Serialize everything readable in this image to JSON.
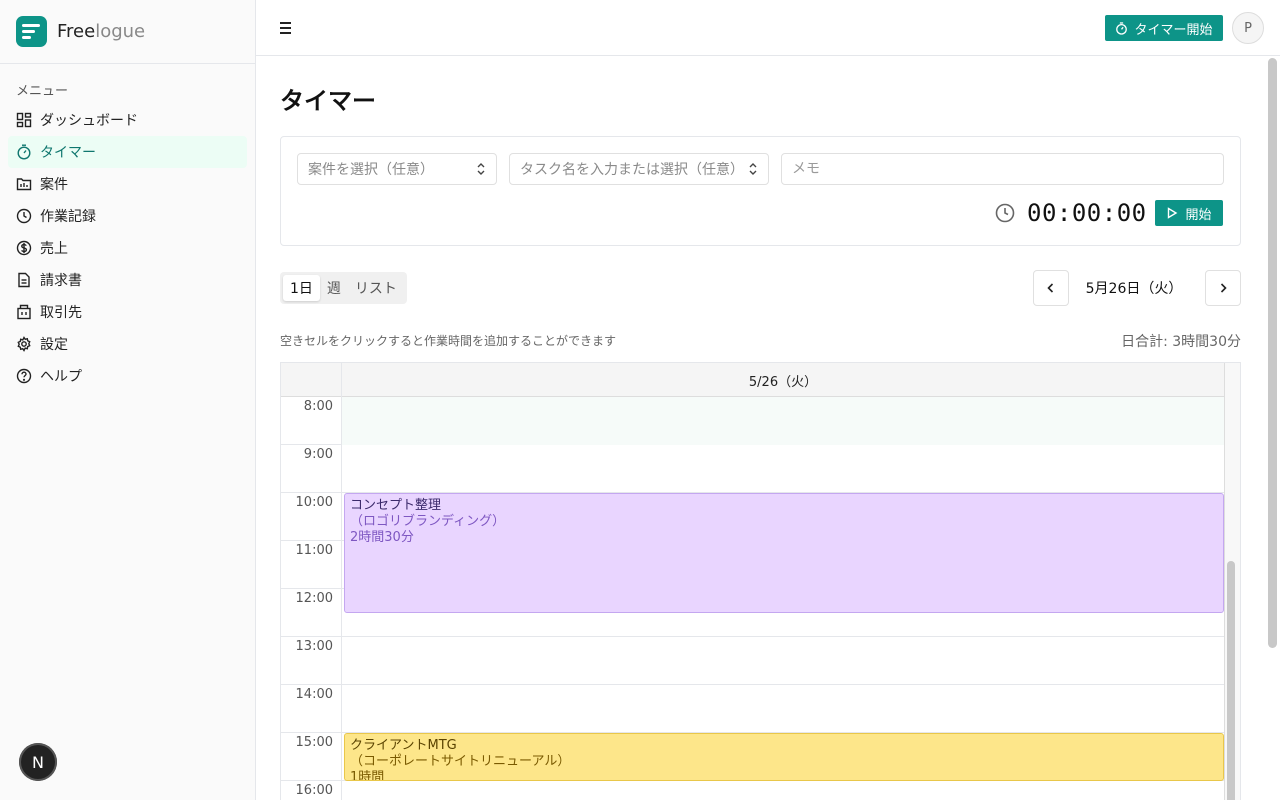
{
  "brand": {
    "name_main": "Free",
    "name_suffix": "logue"
  },
  "sidebar": {
    "heading": "メニュー",
    "items": [
      {
        "label": "ダッシュボード",
        "icon": "dashboard-icon"
      },
      {
        "label": "タイマー",
        "icon": "stopwatch-icon",
        "active": true
      },
      {
        "label": "案件",
        "icon": "folder-icon"
      },
      {
        "label": "作業記録",
        "icon": "clock-icon"
      },
      {
        "label": "売上",
        "icon": "dollar-icon"
      },
      {
        "label": "請求書",
        "icon": "document-icon"
      },
      {
        "label": "取引先",
        "icon": "building-icon"
      },
      {
        "label": "設定",
        "icon": "gear-icon"
      },
      {
        "label": "ヘルプ",
        "icon": "help-icon"
      }
    ],
    "badge": "N"
  },
  "header": {
    "timer_button": "タイマー開始",
    "avatar_initial": "P"
  },
  "page": {
    "title": "タイマー"
  },
  "timer": {
    "project_placeholder": "案件を選択（任意）",
    "task_placeholder": "タスク名を入力または選択（任意）",
    "memo_placeholder": "メモ",
    "elapsed": "00:00:00",
    "start_label": "開始"
  },
  "view": {
    "tabs": [
      "1日",
      "週",
      "リスト"
    ],
    "active_tab": "1日",
    "date": "5月26日（火）",
    "hint": "空きセルをクリックすると作業時間を追加することができます",
    "daily_total": "日合計: 3時間30分"
  },
  "calendar": {
    "day_header": "5/26（火）",
    "hours": [
      "8:00",
      "9:00",
      "10:00",
      "11:00",
      "12:00",
      "13:00",
      "14:00",
      "15:00",
      "16:00"
    ],
    "events": [
      {
        "title": "コンセプト整理",
        "project": "（ロゴリブランディング）",
        "duration": "2時間30分",
        "color": "#e9d5ff"
      },
      {
        "title": "クライアントMTG",
        "project": "（コーポレートサイトリニューアル）",
        "duration": "1時間",
        "color": "#fde68a"
      }
    ]
  },
  "colors": {
    "accent": "#0d9488",
    "active_bg": "#ecfdf5"
  }
}
